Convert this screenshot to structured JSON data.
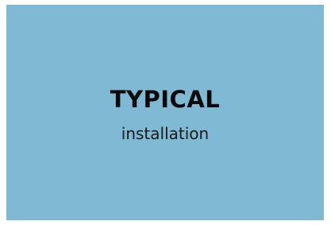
{
  "tile": {
    "title": "TYPICAL",
    "subtitle": "installation",
    "background_color": "#80b9d3",
    "text_color": "#0a0a0a"
  }
}
